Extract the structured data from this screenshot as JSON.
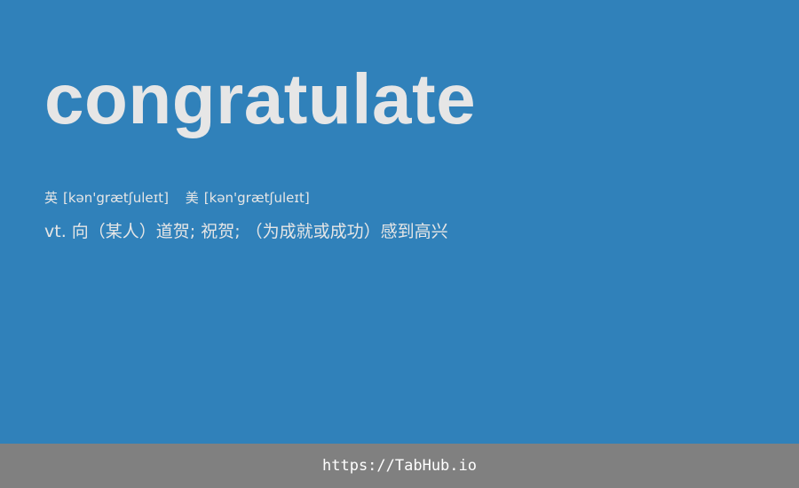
{
  "word": "congratulate",
  "pronunciation": {
    "uk": {
      "label": "英",
      "ipa": "[kən'grætʃuleɪt]"
    },
    "us": {
      "label": "美",
      "ipa": "[kən'grætʃuleɪt]"
    }
  },
  "definition": "vt. 向（某人）道贺; 祝贺; （为成就或成功）感到高兴",
  "footer": {
    "url": "https://TabHub.io"
  },
  "colors": {
    "background": "#3081ba",
    "text": "#e6e6e6",
    "footer_background": "#808080",
    "footer_text": "#ffffff"
  }
}
